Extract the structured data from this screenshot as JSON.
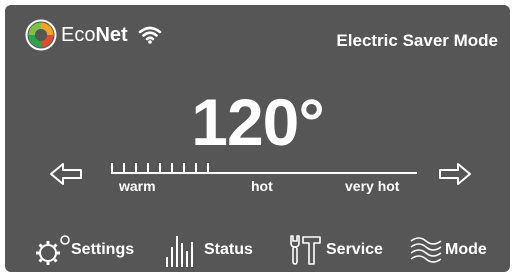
{
  "header": {
    "brand_eco": "Eco",
    "brand_net": "Net",
    "mode_title": "Electric Saver Mode",
    "icons": [
      "econet-logo-icon",
      "wifi-icon"
    ]
  },
  "temperature": {
    "value": "120°"
  },
  "scale": {
    "labels": [
      "warm",
      "hot",
      "very hot"
    ],
    "tick_count": 9,
    "icons": [
      "arrow-left-icon",
      "arrow-right-icon"
    ]
  },
  "nav": {
    "settings_label": "Settings",
    "status_label": "Status",
    "service_label": "Service",
    "mode_label": "Mode",
    "icons": [
      "gear-icon",
      "bars-icon",
      "tools-icon",
      "waves-icon"
    ]
  },
  "colors": {
    "screen_background": "#565656",
    "foreground": "#ffffff"
  }
}
